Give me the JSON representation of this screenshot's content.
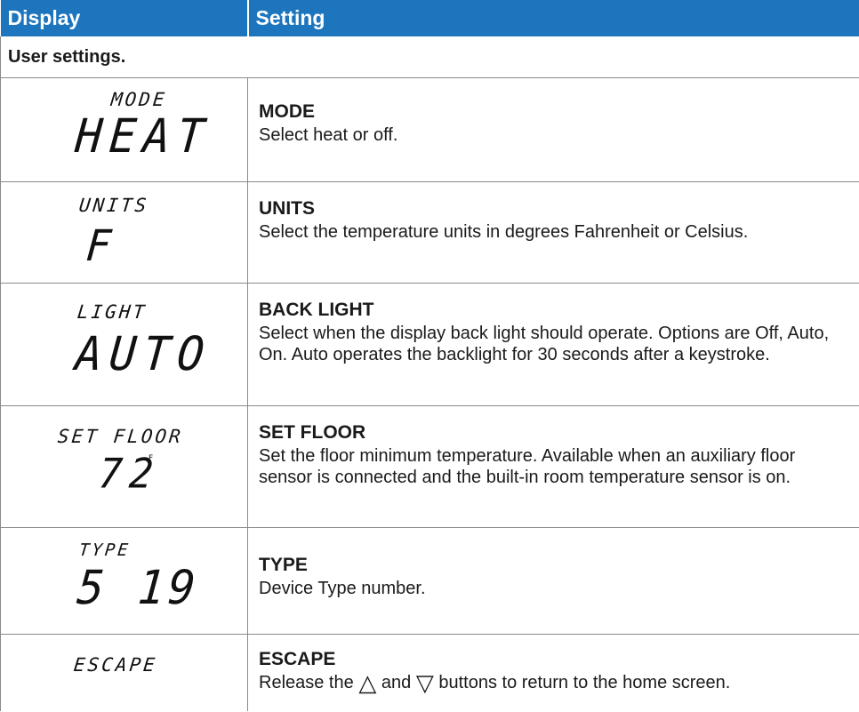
{
  "header": {
    "display": "Display",
    "setting": "Setting"
  },
  "section": "User settings.",
  "rows": [
    {
      "lcd_small": "MODE",
      "lcd_big": "HEAT",
      "title": "MODE",
      "desc": "Select heat or off."
    },
    {
      "lcd_small": "UNITS",
      "lcd_big": "F",
      "title": "UNITS",
      "desc": "Select the temperature units in degrees Fahrenheit or Celsius."
    },
    {
      "lcd_small": "LIGHT",
      "lcd_big": "AUTO",
      "title": "BACK LIGHT",
      "desc": "Select when the display back light should operate. Options are Off, Auto, On. Auto operates the backlight for 30 seconds after a keystroke."
    },
    {
      "lcd_small": "SET FLOOR",
      "lcd_big": "72",
      "lcd_unit": "F",
      "title": "SET FLOOR",
      "desc": "Set the floor minimum temperature. Available when an auxiliary floor sensor is connected and the built-in room temperature sensor is on."
    },
    {
      "lcd_small": "TYPE",
      "lcd_big": "5 19",
      "title": "TYPE",
      "desc": "Device Type number."
    },
    {
      "lcd_small": "ESCAPE",
      "title": "ESCAPE",
      "desc_pre": "Release the",
      "desc_and": "and",
      "desc_post": "buttons to return to the home screen."
    }
  ],
  "icons": {
    "up": "up-triangle-icon",
    "down": "down-triangle-icon"
  },
  "colors": {
    "header_bg": "#1d75bd",
    "header_text": "#ffffff"
  }
}
